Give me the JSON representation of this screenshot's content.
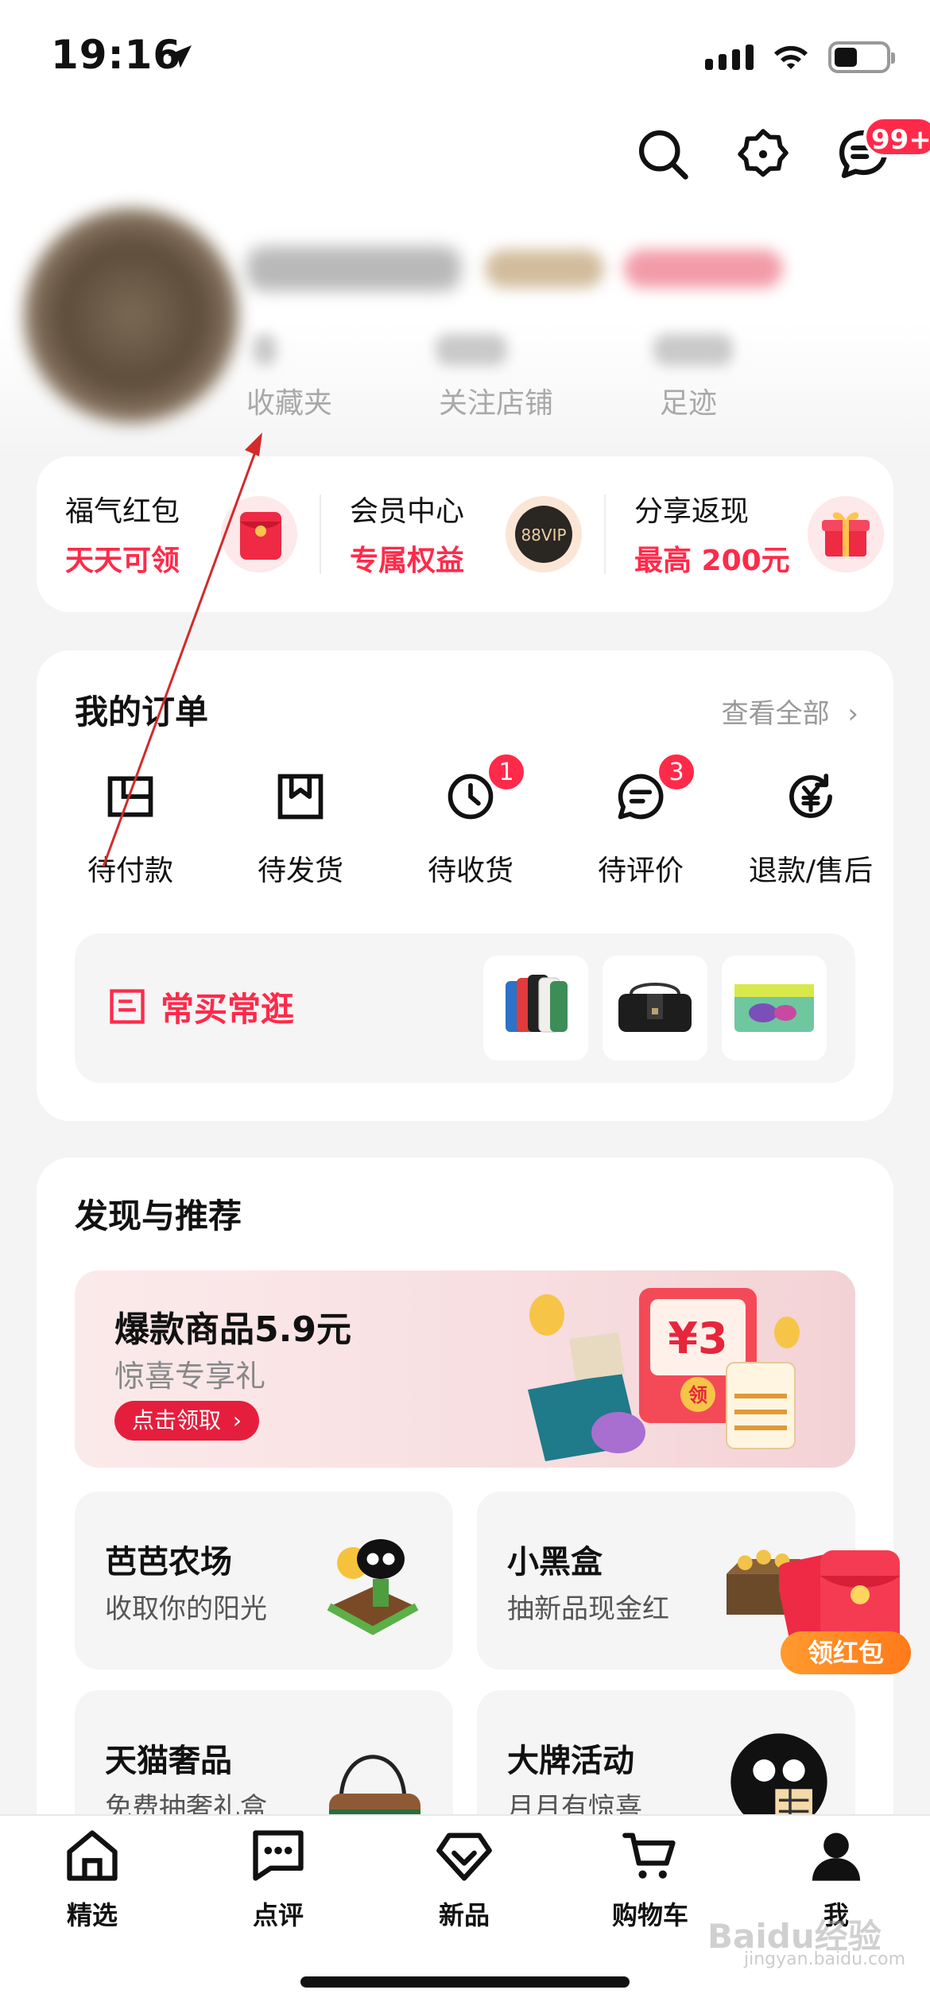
{
  "status_bar": {
    "time": "19:16",
    "battery_level_percent": 45
  },
  "header": {
    "message_badge": "99+"
  },
  "profile": {
    "stats": [
      {
        "label": "收藏夹"
      },
      {
        "label": "关注店铺"
      },
      {
        "label": "足迹"
      }
    ]
  },
  "promos": [
    {
      "title": "福气红包",
      "subtitle": "天天可领"
    },
    {
      "title": "会员中心",
      "subtitle": "专属权益",
      "image_text": "88VIP"
    },
    {
      "title": "分享返现",
      "subtitle": "最高 200元"
    }
  ],
  "orders": {
    "title": "我的订单",
    "view_all": "查看全部",
    "items": [
      {
        "label": "待付款"
      },
      {
        "label": "待发货"
      },
      {
        "label": "待收货",
        "badge": "1"
      },
      {
        "label": "待评价",
        "badge": "3"
      },
      {
        "label": "退款/售后"
      }
    ],
    "frequent_label": "常买常逛"
  },
  "discover": {
    "title": "发现与推荐",
    "banner": {
      "title": "爆款商品5.9元",
      "subtitle": "惊喜专享礼",
      "button": "点击领取",
      "price_tag": "¥3",
      "coupon_text": "领"
    },
    "tiles": [
      {
        "title": "芭芭农场",
        "subtitle": "收取你的阳光"
      },
      {
        "title": "小黑盒",
        "subtitle": "抽新品现金红"
      },
      {
        "title": "天猫奢品",
        "subtitle": "免费抽奢礼盒"
      },
      {
        "title": "大牌活动",
        "subtitle": "月月有惊喜"
      }
    ]
  },
  "floating": {
    "label": "领红包"
  },
  "tab_bar": [
    {
      "label": "精选"
    },
    {
      "label": "点评"
    },
    {
      "label": "新品"
    },
    {
      "label": "购物车"
    },
    {
      "label": "我"
    }
  ],
  "watermark": {
    "brand": "Baidu经验",
    "sub": "jingyan.baidu.com"
  },
  "colors": {
    "accent": "#ff2a4a",
    "orange": "#ff8a24"
  }
}
